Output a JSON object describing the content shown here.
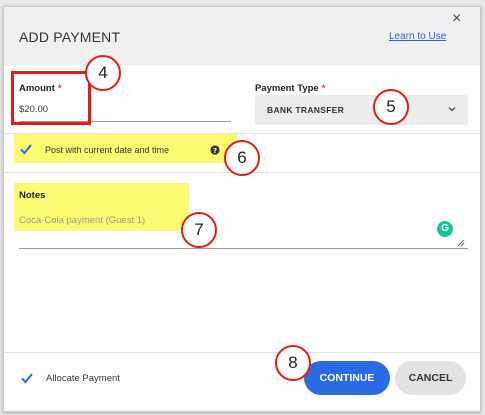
{
  "dialog": {
    "title": "ADD PAYMENT",
    "learn_link": "Learn to Use",
    "close_glyph": "×"
  },
  "amount": {
    "label": "Amount",
    "required_mark": "*",
    "value": "$20.00"
  },
  "payment_type": {
    "label": "Payment Type",
    "required_mark": "*",
    "selected": "BANK TRANSFER"
  },
  "post_option": {
    "label": "Post with current date and time",
    "checked": true
  },
  "notes": {
    "label": "Notes",
    "value": "Coca-Cola payment (Guest 1)"
  },
  "grammarly": {
    "glyph": "G"
  },
  "footer": {
    "allocate_label": "Allocate Payment",
    "allocate_checked": true,
    "continue_label": "CONTINUE",
    "cancel_label": "CANCEL"
  },
  "annotations": [
    "4",
    "5",
    "6",
    "7",
    "8"
  ],
  "colors": {
    "accent": "#2b6be2",
    "highlight": "#fbfb5a",
    "annotation_red": "#e01b1b",
    "required": "#e53935",
    "grammarly": "#15c39a"
  }
}
